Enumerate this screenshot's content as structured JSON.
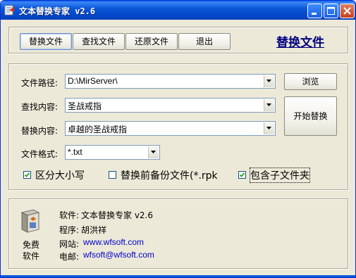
{
  "window": {
    "title": "文本替换专家 v2.6"
  },
  "toolbar": {
    "replace_files": "替换文件",
    "find_files": "查找文件",
    "restore_files": "还原文件",
    "exit": "退出",
    "heading_link": "替换文件"
  },
  "form": {
    "path_label": "文件路径:",
    "path_value": "D:\\MirServer\\",
    "find_label": "查找内容:",
    "find_value": "圣战戒指",
    "replace_label": "替换内容:",
    "replace_value": "卓越的圣战戒指",
    "format_label": "文件格式:",
    "format_value": "*.txt",
    "browse": "浏览",
    "start": "开始替换"
  },
  "options": {
    "case_sensitive": {
      "label": "区分大小写",
      "checked": true
    },
    "backup": {
      "label": "替换前备份文件(*.rpk",
      "checked": false
    },
    "subfolders": {
      "label": "包含子文件夹",
      "checked": true
    }
  },
  "about": {
    "free_line1": "免费",
    "free_line2": "软件",
    "software_label": "软件:",
    "software_value": "文本替换专家 v2.6",
    "author_label": "程序:",
    "author_value": "胡洪祥",
    "website_label": "网站:",
    "website_value": "www.wfsoft.com",
    "email_label": "电邮:",
    "email_value": "wfsoft@wfsoft.com"
  },
  "colors": {
    "title_bar": "#0b57d9",
    "window_bg": "#ece9d8",
    "link": "#000080",
    "url": "#0000cc"
  },
  "icons": [
    "app-icon",
    "minimize-icon",
    "maximize-icon",
    "close-icon",
    "dropdown-arrow-icon",
    "checkmark-icon",
    "software-box-icon"
  ]
}
